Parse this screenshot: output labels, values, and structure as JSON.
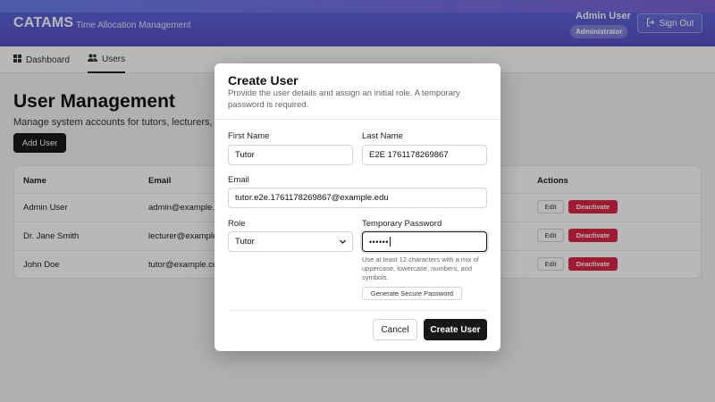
{
  "header": {
    "brand": "CATAMS",
    "subtitle": "Time Allocation Management",
    "user_name": "Admin User",
    "user_role": "Administrator",
    "sign_out_label": "Sign Out"
  },
  "nav": {
    "items": [
      {
        "label": "Dashboard",
        "icon": "grid-icon"
      },
      {
        "label": "Users",
        "icon": "users-icon"
      }
    ],
    "active": "Users"
  },
  "main": {
    "title": "User Management",
    "description": "Manage system accounts for tutors, lecturers, a",
    "add_user_label": "Add User"
  },
  "table": {
    "headers": [
      "Name",
      "Email",
      "Actions"
    ],
    "rows": [
      {
        "name": "Admin User",
        "email": "admin@example.c",
        "edit": "Edit",
        "deactivate": "Deactivate"
      },
      {
        "name": "Dr. Jane Smith",
        "email": "lecturer@example",
        "edit": "Edit",
        "deactivate": "Deactivate"
      },
      {
        "name": "John Doe",
        "email": "tutor@example.co",
        "edit": "Edit",
        "deactivate": "Deactivate"
      }
    ]
  },
  "modal": {
    "title": "Create User",
    "description": "Provide the user details and assign an initial role. A temporary password is required.",
    "first_name_label": "First Name",
    "first_name_value": "Tutor",
    "last_name_label": "Last Name",
    "last_name_value": "E2E 1761178269867",
    "email_label": "Email",
    "email_value": "tutor.e2e.1761178269867@example.edu",
    "role_label": "Role",
    "role_value": "Tutor",
    "password_label": "Temporary Password",
    "password_value": "••••••",
    "password_hint": "Use at least 12 characters with a mix of uppercase, lowercase, numbers, and symbols.",
    "generate_label": "Generate Secure Password",
    "cancel_label": "Cancel",
    "create_label": "Create User"
  },
  "colors": {
    "header_gradient_start": "#5b6be0",
    "header_gradient_end": "#5a4fc8",
    "primary_button": "#18181b",
    "danger": "#dc2645"
  }
}
